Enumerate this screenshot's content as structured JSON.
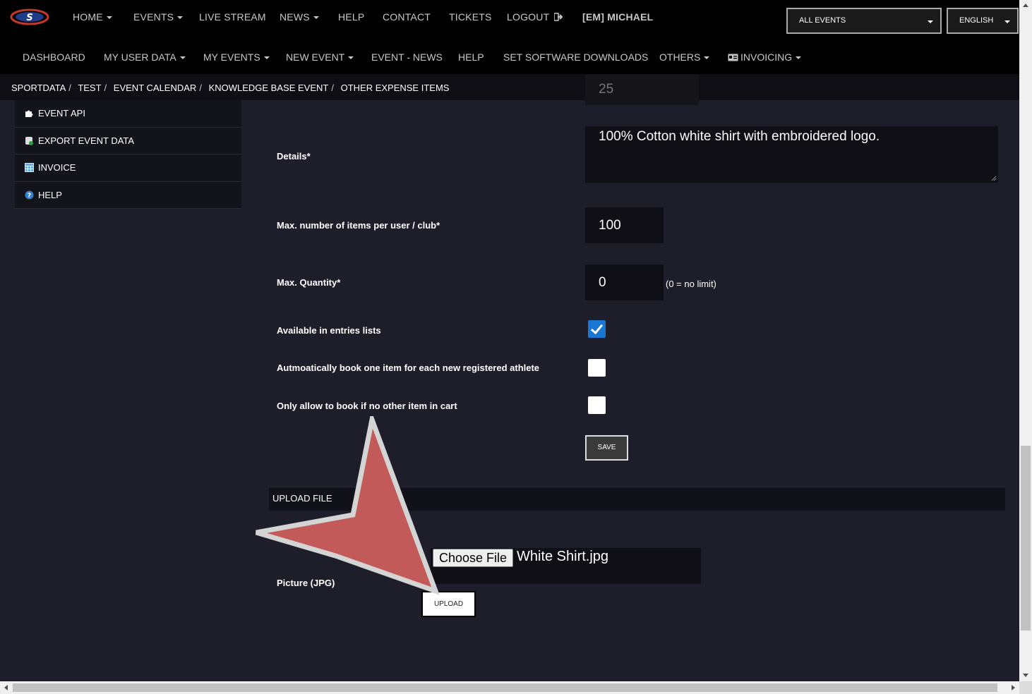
{
  "topnav": {
    "home": "HOME",
    "events": "EVENTS",
    "live_stream": "LIVE STREAM",
    "news": "NEWS",
    "help": "HELP",
    "contact": "CONTACT",
    "tickets": "TICKETS",
    "logout": "LOGOUT",
    "user": "[EM] MICHAEL",
    "event_select": "ALL EVENTS",
    "language_select": "ENGLISH"
  },
  "subnav": {
    "dashboard": "DASHBOARD",
    "my_user_data": "MY USER DATA",
    "my_events": "MY EVENTS",
    "new_event": "NEW EVENT",
    "event_news": "EVENT - NEWS",
    "help": "HELP",
    "set_software_downloads": "SET SOFTWARE DOWNLOADS",
    "others": "OTHERS",
    "invoicing": "INVOICING"
  },
  "breadcrumb": [
    "SPORTDATA",
    "TEST",
    "EVENT CALENDAR",
    "KNOWLEDGE BASE EVENT",
    "OTHER EXPENSE ITEMS"
  ],
  "sidebar": {
    "items": [
      {
        "label": "EVENT API",
        "icon": "puzzle-icon"
      },
      {
        "label": "EXPORT EVENT DATA",
        "icon": "database-export-icon"
      },
      {
        "label": "INVOICE",
        "icon": "table-icon"
      },
      {
        "label": "HELP",
        "icon": "help-circle-icon"
      }
    ]
  },
  "form": {
    "partial_value": "25",
    "details_label": "Details*",
    "details_value": "100% Cotton white shirt with embroidered logo.",
    "max_items_label": "Max. number of items per user / club*",
    "max_items_value": "100",
    "max_quantity_label": "Max. Quantity*",
    "max_quantity_value": "0",
    "max_quantity_hint": "(0 = no limit)",
    "available_label": "Available in entries lists",
    "available_checked": true,
    "auto_book_label": "Autmoatically book one item for each new registered athlete",
    "auto_book_checked": false,
    "only_allow_label": "Only allow to book if no other item in cart",
    "only_allow_checked": false,
    "save_label": "SAVE"
  },
  "upload": {
    "section_title": "UPLOAD FILE",
    "picture_label": "Picture (JPG)",
    "choose_label": "Choose File",
    "file_name": "White Shirt.jpg",
    "upload_label": "UPLOAD"
  },
  "colors": {
    "background": "#1e1e2a",
    "nav": "#000000",
    "accent_checkbox": "#1976d2",
    "annotation_arrow": "#c25a5a"
  }
}
